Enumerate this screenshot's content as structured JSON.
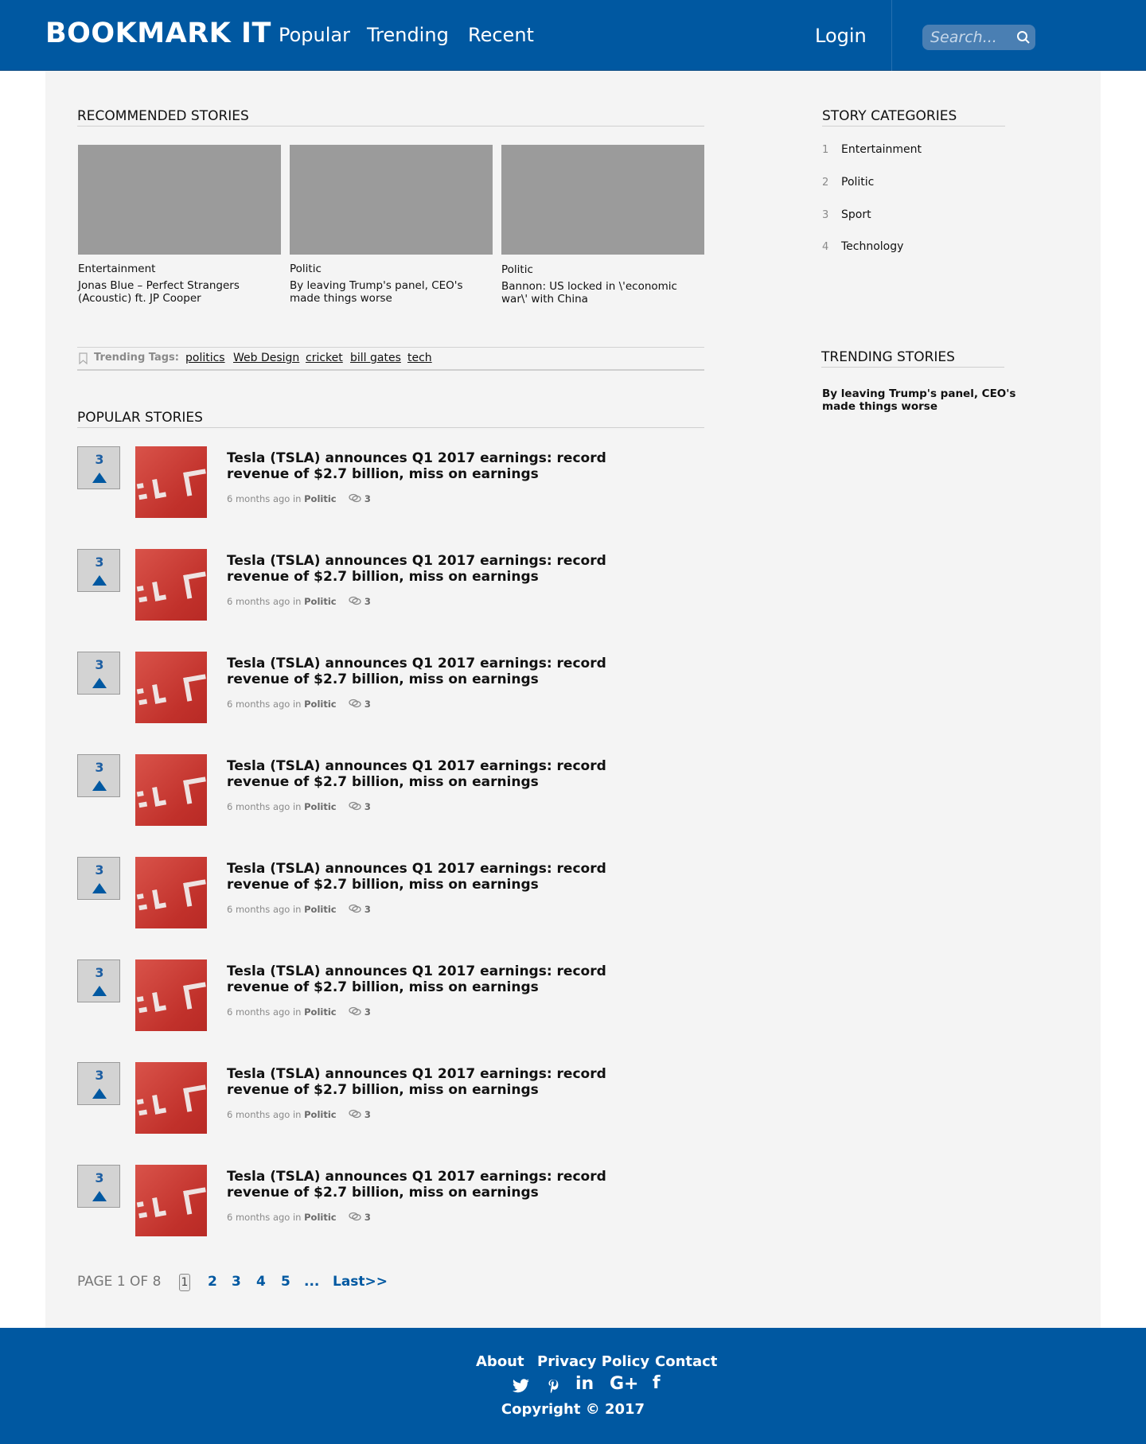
{
  "header": {
    "logo": "BOOKMARK IT",
    "nav": [
      "Popular",
      "Trending",
      "Recent"
    ],
    "login": "Login",
    "search_placeholder": "Search..."
  },
  "recommended": {
    "title": "RECOMMENDED STORIES",
    "items": [
      {
        "category": "Entertainment",
        "title": "Jonas Blue – Perfect Strangers (Acoustic) ft. JP Cooper"
      },
      {
        "category": "Politic",
        "title": "By leaving Trump's panel, CEO's made things worse"
      },
      {
        "category": "Politic",
        "title": "Bannon: US locked in \\'economic war\\' with China"
      }
    ]
  },
  "trending_tags": {
    "label": "Trending Tags:",
    "tags": [
      "politics",
      "Web Design",
      "cricket",
      "bill gates",
      "tech"
    ]
  },
  "popular": {
    "title": "POPULAR STORIES",
    "stories": [
      {
        "votes": "3",
        "title": "Tesla (TSLA) announces Q1 2017 earnings: record revenue of $2.7 billion, miss on earnings",
        "time": "6 months ago",
        "in_label": "in",
        "category": "Politic",
        "comments": "3"
      },
      {
        "votes": "3",
        "title": "Tesla (TSLA) announces Q1 2017 earnings: record revenue of $2.7 billion, miss on earnings",
        "time": "6 months ago",
        "in_label": "in",
        "category": "Politic",
        "comments": "3"
      },
      {
        "votes": "3",
        "title": "Tesla (TSLA) announces Q1 2017 earnings: record revenue of $2.7 billion, miss on earnings",
        "time": "6 months ago",
        "in_label": "in",
        "category": "Politic",
        "comments": "3"
      },
      {
        "votes": "3",
        "title": "Tesla (TSLA) announces Q1 2017 earnings: record revenue of $2.7 billion, miss on earnings",
        "time": "6 months ago",
        "in_label": "in",
        "category": "Politic",
        "comments": "3"
      },
      {
        "votes": "3",
        "title": "Tesla (TSLA) announces Q1 2017 earnings: record revenue of $2.7 billion, miss on earnings",
        "time": "6 months ago",
        "in_label": "in",
        "category": "Politic",
        "comments": "3"
      },
      {
        "votes": "3",
        "title": "Tesla (TSLA) announces Q1 2017 earnings: record revenue of $2.7 billion, miss on earnings",
        "time": "6 months ago",
        "in_label": "in",
        "category": "Politic",
        "comments": "3"
      },
      {
        "votes": "3",
        "title": "Tesla (TSLA) announces Q1 2017 earnings: record revenue of $2.7 billion, miss on earnings",
        "time": "6 months ago",
        "in_label": "in",
        "category": "Politic",
        "comments": "3"
      },
      {
        "votes": "3",
        "title": "Tesla (TSLA) announces Q1 2017 earnings: record revenue of $2.7 billion, miss on earnings",
        "time": "6 months ago",
        "in_label": "in",
        "category": "Politic",
        "comments": "3"
      }
    ]
  },
  "pagination": {
    "label": "PAGE 1 OF 8",
    "current": "1",
    "pages": [
      "2",
      "3",
      "4",
      "5"
    ],
    "ellipsis": "...",
    "last": "Last>>"
  },
  "categories": {
    "title": "STORY CATEGORIES",
    "items": [
      {
        "num": "1",
        "label": "Entertainment"
      },
      {
        "num": "2",
        "label": "Politic"
      },
      {
        "num": "3",
        "label": "Sport"
      },
      {
        "num": "4",
        "label": "Technology"
      }
    ]
  },
  "trending": {
    "title": "TRENDING STORIES",
    "story": "By leaving Trump's panel, CEO's made things worse"
  },
  "footer": {
    "links": [
      "About",
      "Privacy Policy",
      "Contact"
    ],
    "social": [
      "twitter-icon",
      "pinterest-icon",
      "linkedin-icon",
      "google-plus-icon",
      "facebook-icon"
    ],
    "linkedin_text": "in",
    "gplus_text": "G+",
    "facebook_text": "f",
    "copyright": "Copyright © 2017"
  },
  "colors": {
    "brand": "#0058a1",
    "vote_arrow": "#0058a1",
    "thumbnail": "#c93a33"
  }
}
